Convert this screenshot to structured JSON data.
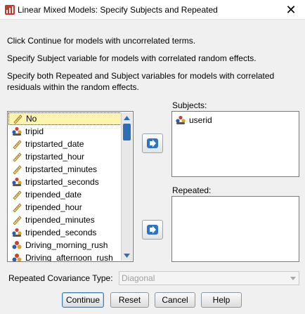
{
  "window": {
    "title": "Linear Mixed Models: Specify Subjects and Repeated",
    "close_glyph": "✕"
  },
  "info": {
    "line1": "Click Continue for models with uncorrelated terms.",
    "line2": "Specify Subject variable for models with correlated random effects.",
    "line3a": "Specify both Repeated and Subject variables for models with correlated",
    "line3b": "residuals within the random effects."
  },
  "variables": [
    {
      "label": "No",
      "icon": "scale-ruler-icon",
      "selected": true
    },
    {
      "label": "tripid",
      "icon": "nominal-people-icon"
    },
    {
      "label": "tripstarted_date",
      "icon": "scale-ruler-icon"
    },
    {
      "label": "tripstarted_hour",
      "icon": "scale-ruler-icon"
    },
    {
      "label": "tripstarted_minutes",
      "icon": "scale-ruler-icon"
    },
    {
      "label": "tripstarted_seconds",
      "icon": "nominal-people-icon"
    },
    {
      "label": "tripended_date",
      "icon": "scale-ruler-icon"
    },
    {
      "label": "tripended_hour",
      "icon": "scale-ruler-icon"
    },
    {
      "label": "tripended_minutes",
      "icon": "scale-ruler-icon"
    },
    {
      "label": "tripended_seconds",
      "icon": "nominal-people-icon"
    },
    {
      "label": "Driving_morning_rush",
      "icon": "nominal-circles-icon"
    },
    {
      "label": "Driving_afternoon_rush",
      "icon": "nominal-circles-icon"
    }
  ],
  "subjects": {
    "label": "Subjects:",
    "items": [
      {
        "label": "userid",
        "icon": "nominal-people-icon"
      }
    ]
  },
  "repeated": {
    "label": "Repeated:"
  },
  "covariance": {
    "label": "Repeated Covariance Type:",
    "value": "Diagonal"
  },
  "buttons": {
    "continue": "Continue",
    "reset": "Reset",
    "cancel": "Cancel",
    "help": "Help"
  },
  "colors": {
    "selection": "#fff3b0",
    "scroll_thumb": "#2c6fb5",
    "move_arrow": "#2d74c4"
  }
}
